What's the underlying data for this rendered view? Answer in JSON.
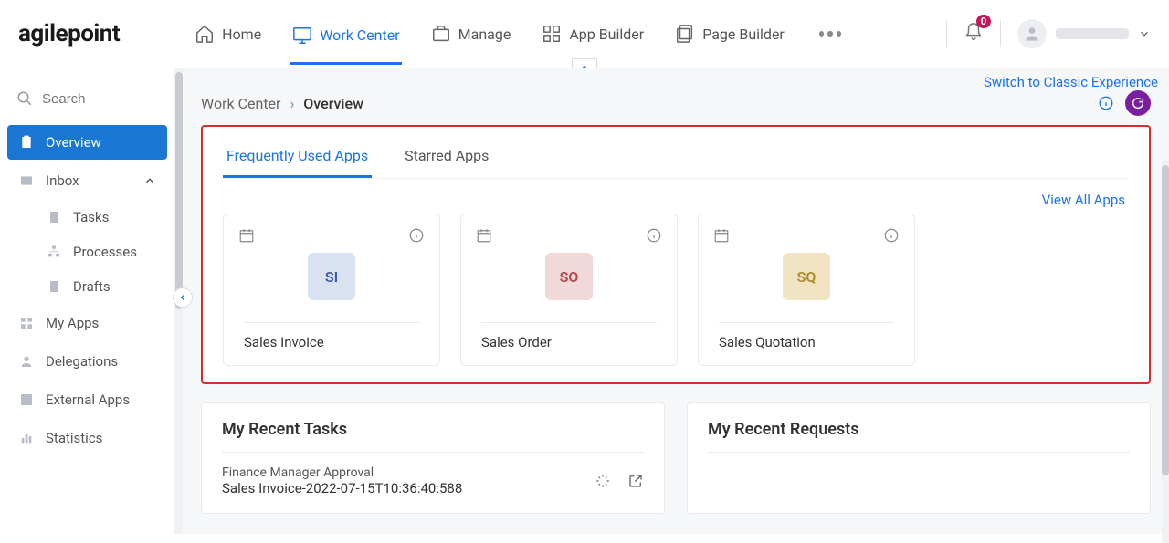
{
  "logo": "agilepoint",
  "topnav": {
    "home": "Home",
    "work_center": "Work Center",
    "manage": "Manage",
    "app_builder": "App Builder",
    "page_builder": "Page Builder"
  },
  "notifications": {
    "count": "0"
  },
  "switch_link": "Switch to Classic Experience",
  "breadcrumb": {
    "root": "Work Center",
    "current": "Overview"
  },
  "subtabs": {
    "frequent": "Frequently Used Apps",
    "starred": "Starred Apps"
  },
  "view_all": "View All Apps",
  "apps": [
    {
      "abbr": "SI",
      "title": "Sales Invoice",
      "badgeClass": "badge-si"
    },
    {
      "abbr": "SO",
      "title": "Sales Order",
      "badgeClass": "badge-so"
    },
    {
      "abbr": "SQ",
      "title": "Sales Quotation",
      "badgeClass": "badge-sq"
    }
  ],
  "sidebar": {
    "search_placeholder": "Search",
    "overview": "Overview",
    "inbox": "Inbox",
    "tasks": "Tasks",
    "processes": "Processes",
    "drafts": "Drafts",
    "my_apps": "My Apps",
    "delegations": "Delegations",
    "external_apps": "External Apps",
    "statistics": "Statistics"
  },
  "recent_tasks": {
    "title": "My Recent Tasks",
    "task_name": "Finance Manager Approval",
    "task_sub": "Sales Invoice-2022-07-15T10:36:40:588"
  },
  "recent_requests": {
    "title": "My Recent Requests"
  }
}
